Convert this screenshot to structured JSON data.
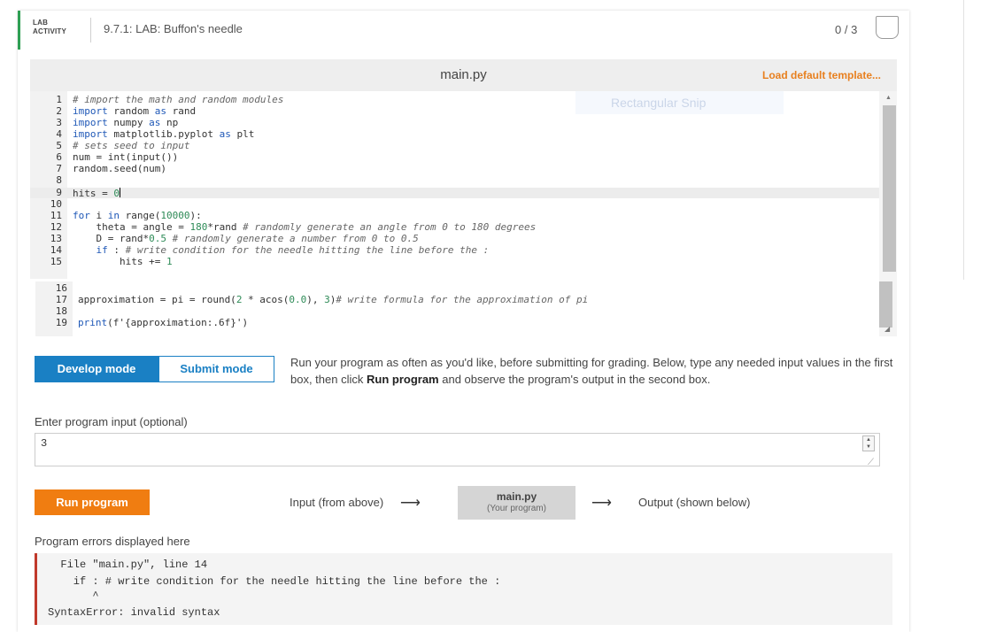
{
  "lab": {
    "tag_line1": "LAB",
    "tag_line2": "ACTIVITY",
    "title": "9.7.1: LAB: Buffon's needle",
    "score": "0 / 3"
  },
  "editor": {
    "filename": "main.py",
    "load_template": "Load default template...",
    "faint_overlay": "Rectangular Snip"
  },
  "code_lines": [
    {
      "n": "1",
      "text": "# import the math and random modules"
    },
    {
      "n": "2",
      "text": "import random as rand"
    },
    {
      "n": "3",
      "text": "import numpy as np"
    },
    {
      "n": "4",
      "text": "import matplotlib.pyplot as plt"
    },
    {
      "n": "5",
      "text": "# sets seed to input"
    },
    {
      "n": "6",
      "text": "num = int(input())"
    },
    {
      "n": "7",
      "text": "random.seed(num)"
    },
    {
      "n": "8",
      "text": ""
    },
    {
      "n": "9",
      "text": "hits = 0"
    },
    {
      "n": "10",
      "text": ""
    },
    {
      "n": "11",
      "text": "for i in range(10000):"
    },
    {
      "n": "12",
      "text": "    theta = angle = 180*rand # randomly generate an angle from 0 to 180 degrees"
    },
    {
      "n": "13",
      "text": "    D = rand*0.5 # randomly generate a number from 0 to 0.5"
    },
    {
      "n": "14",
      "text": "    if : # write condition for the needle hitting the line before the :"
    },
    {
      "n": "15",
      "text": "        hits += 1"
    },
    {
      "n": "16",
      "text": ""
    },
    {
      "n": "17",
      "text": "approximation = pi = round(2 * acos(0.0), 3)# write formula for the approximation of pi"
    },
    {
      "n": "18",
      "text": ""
    },
    {
      "n": "19",
      "text": "print(f'{approximation:.6f}')"
    }
  ],
  "modes": {
    "develop": "Develop mode",
    "submit": "Submit mode",
    "desc_part1": "Run your program as often as you'd like, before submitting for grading. Below, type any needed input values in the first box, then click ",
    "desc_bold": "Run program",
    "desc_part2": " and observe the program's output in the second box."
  },
  "input": {
    "label": "Enter program input (optional)",
    "value": "3"
  },
  "run": {
    "button": "Run program",
    "flow_input": "Input (from above)",
    "program_name": "main.py",
    "program_sub": "(Your program)",
    "flow_output": "Output (shown below)"
  },
  "errors": {
    "label": "Program errors displayed here",
    "lines": [
      "  File \"main.py\", line 14",
      "    if : # write condition for the needle hitting the line before the :",
      "       ^",
      "SyntaxError: invalid syntax"
    ]
  },
  "colors": {
    "accent_green": "#2e9f53",
    "mode_blue": "#1a80c4",
    "run_orange": "#f07d11",
    "load_orange": "#e8801f",
    "error_red": "#c0392b"
  }
}
